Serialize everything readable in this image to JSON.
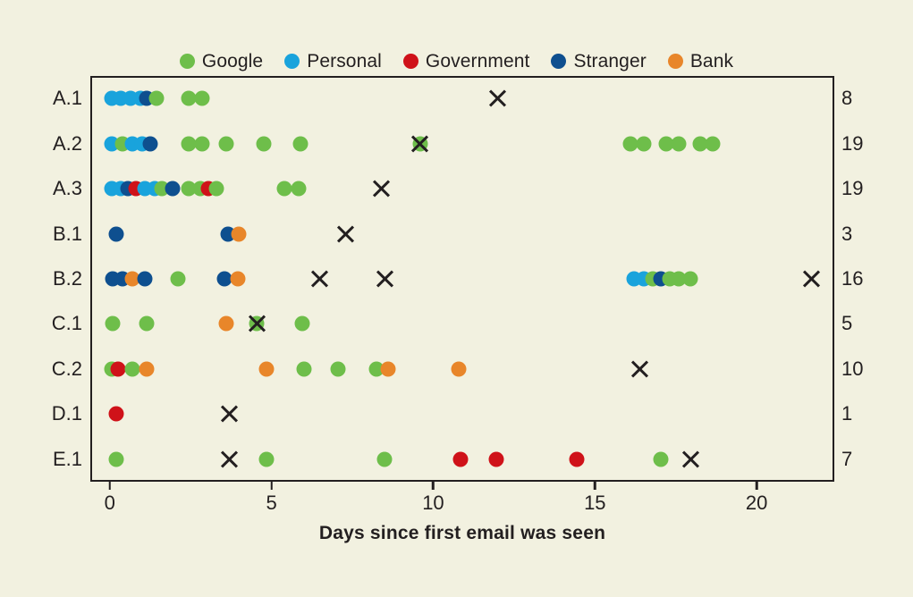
{
  "chart_data": {
    "type": "scatter",
    "title": "",
    "xlabel": "Days since first email was seen",
    "ylabel": "",
    "xlim": [
      -0.6,
      22.4
    ],
    "xticks": [
      0,
      5,
      10,
      15,
      20
    ],
    "xtick_labels": [
      "0",
      "5",
      "10",
      "15",
      "20"
    ],
    "grid": false,
    "legend_position": "top-center",
    "legend": [
      {
        "name": "Google",
        "color": "#6ebe4a"
      },
      {
        "name": "Personal",
        "color": "#19a3dc"
      },
      {
        "name": "Government",
        "color": "#cf1219"
      },
      {
        "name": "Stranger",
        "color": "#0e4f8f"
      },
      {
        "name": "Bank",
        "color": "#e8862a"
      }
    ],
    "marker_x": {
      "name": "x-marker",
      "color": "#231f20"
    },
    "categories": [
      "A.1",
      "A.2",
      "A.3",
      "B.1",
      "B.2",
      "C.1",
      "C.2",
      "D.1",
      "E.1"
    ],
    "counts": [
      8,
      19,
      19,
      3,
      16,
      5,
      10,
      1,
      7
    ],
    "rows": [
      {
        "label": "A.1",
        "count": 8,
        "points": [
          {
            "x": 0.05,
            "series": "Personal"
          },
          {
            "x": 0.35,
            "series": "Personal"
          },
          {
            "x": 0.65,
            "series": "Personal"
          },
          {
            "x": 0.95,
            "series": "Personal"
          },
          {
            "x": 1.15,
            "series": "Stranger"
          },
          {
            "x": 1.45,
            "series": "Google"
          },
          {
            "x": 2.45,
            "series": "Google"
          },
          {
            "x": 2.85,
            "series": "Google"
          }
        ],
        "x_marks": [
          12.0
        ]
      },
      {
        "label": "A.2",
        "count": 19,
        "points": [
          {
            "x": 0.05,
            "series": "Personal"
          },
          {
            "x": 0.4,
            "series": "Google"
          },
          {
            "x": 0.7,
            "series": "Personal"
          },
          {
            "x": 1.0,
            "series": "Personal"
          },
          {
            "x": 1.25,
            "series": "Stranger"
          },
          {
            "x": 2.45,
            "series": "Google"
          },
          {
            "x": 2.85,
            "series": "Google"
          },
          {
            "x": 3.6,
            "series": "Google"
          },
          {
            "x": 4.75,
            "series": "Google"
          },
          {
            "x": 5.9,
            "series": "Google"
          },
          {
            "x": 9.6,
            "series": "Google"
          },
          {
            "x": 16.1,
            "series": "Google"
          },
          {
            "x": 16.5,
            "series": "Google"
          },
          {
            "x": 17.2,
            "series": "Google"
          },
          {
            "x": 17.6,
            "series": "Google"
          },
          {
            "x": 18.25,
            "series": "Google"
          },
          {
            "x": 18.65,
            "series": "Google"
          }
        ],
        "x_marks": [
          9.6
        ]
      },
      {
        "label": "A.3",
        "count": 19,
        "points": [
          {
            "x": 0.05,
            "series": "Personal"
          },
          {
            "x": 0.35,
            "series": "Personal"
          },
          {
            "x": 0.55,
            "series": "Stranger"
          },
          {
            "x": 0.8,
            "series": "Government"
          },
          {
            "x": 1.1,
            "series": "Personal"
          },
          {
            "x": 1.4,
            "series": "Personal"
          },
          {
            "x": 1.6,
            "series": "Google"
          },
          {
            "x": 1.95,
            "series": "Stranger"
          },
          {
            "x": 2.45,
            "series": "Google"
          },
          {
            "x": 2.8,
            "series": "Google"
          },
          {
            "x": 3.05,
            "series": "Government"
          },
          {
            "x": 3.3,
            "series": "Google"
          },
          {
            "x": 5.4,
            "series": "Google"
          },
          {
            "x": 5.85,
            "series": "Google"
          }
        ],
        "x_marks": [
          8.4
        ]
      },
      {
        "label": "B.1",
        "count": 3,
        "points": [
          {
            "x": 0.2,
            "series": "Stranger"
          },
          {
            "x": 3.65,
            "series": "Stranger"
          },
          {
            "x": 4.0,
            "series": "Bank"
          }
        ],
        "x_marks": [
          7.3
        ]
      },
      {
        "label": "B.2",
        "count": 16,
        "points": [
          {
            "x": 0.1,
            "series": "Stranger"
          },
          {
            "x": 0.4,
            "series": "Stranger"
          },
          {
            "x": 0.7,
            "series": "Bank"
          },
          {
            "x": 1.1,
            "series": "Stranger"
          },
          {
            "x": 2.1,
            "series": "Google"
          },
          {
            "x": 3.55,
            "series": "Stranger"
          },
          {
            "x": 3.95,
            "series": "Bank"
          },
          {
            "x": 16.2,
            "series": "Personal"
          },
          {
            "x": 16.5,
            "series": "Personal"
          },
          {
            "x": 16.8,
            "series": "Google"
          },
          {
            "x": 17.05,
            "series": "Stranger"
          },
          {
            "x": 17.3,
            "series": "Google"
          },
          {
            "x": 17.6,
            "series": "Google"
          },
          {
            "x": 17.95,
            "series": "Google"
          }
        ],
        "x_marks": [
          6.5,
          8.5,
          21.7
        ]
      },
      {
        "label": "C.1",
        "count": 5,
        "points": [
          {
            "x": 0.1,
            "series": "Google"
          },
          {
            "x": 1.15,
            "series": "Google"
          },
          {
            "x": 3.6,
            "series": "Bank"
          },
          {
            "x": 4.55,
            "series": "Google"
          },
          {
            "x": 5.95,
            "series": "Google"
          }
        ],
        "x_marks": [
          4.55
        ]
      },
      {
        "label": "C.2",
        "count": 10,
        "points": [
          {
            "x": 0.05,
            "series": "Google"
          },
          {
            "x": 0.25,
            "series": "Government"
          },
          {
            "x": 0.7,
            "series": "Google"
          },
          {
            "x": 1.15,
            "series": "Bank"
          },
          {
            "x": 4.85,
            "series": "Bank"
          },
          {
            "x": 6.0,
            "series": "Google"
          },
          {
            "x": 7.05,
            "series": "Google"
          },
          {
            "x": 8.25,
            "series": "Google"
          },
          {
            "x": 8.6,
            "series": "Bank"
          },
          {
            "x": 10.8,
            "series": "Bank"
          }
        ],
        "x_marks": [
          16.4
        ]
      },
      {
        "label": "D.1",
        "count": 1,
        "points": [
          {
            "x": 0.2,
            "series": "Government"
          }
        ],
        "x_marks": [
          3.7
        ]
      },
      {
        "label": "E.1",
        "count": 7,
        "points": [
          {
            "x": 0.2,
            "series": "Google"
          },
          {
            "x": 4.85,
            "series": "Google"
          },
          {
            "x": 8.5,
            "series": "Google"
          },
          {
            "x": 10.85,
            "series": "Government"
          },
          {
            "x": 11.95,
            "series": "Government"
          },
          {
            "x": 14.45,
            "series": "Government"
          },
          {
            "x": 17.05,
            "series": "Google"
          }
        ],
        "x_marks": [
          3.7,
          17.95
        ]
      }
    ]
  }
}
